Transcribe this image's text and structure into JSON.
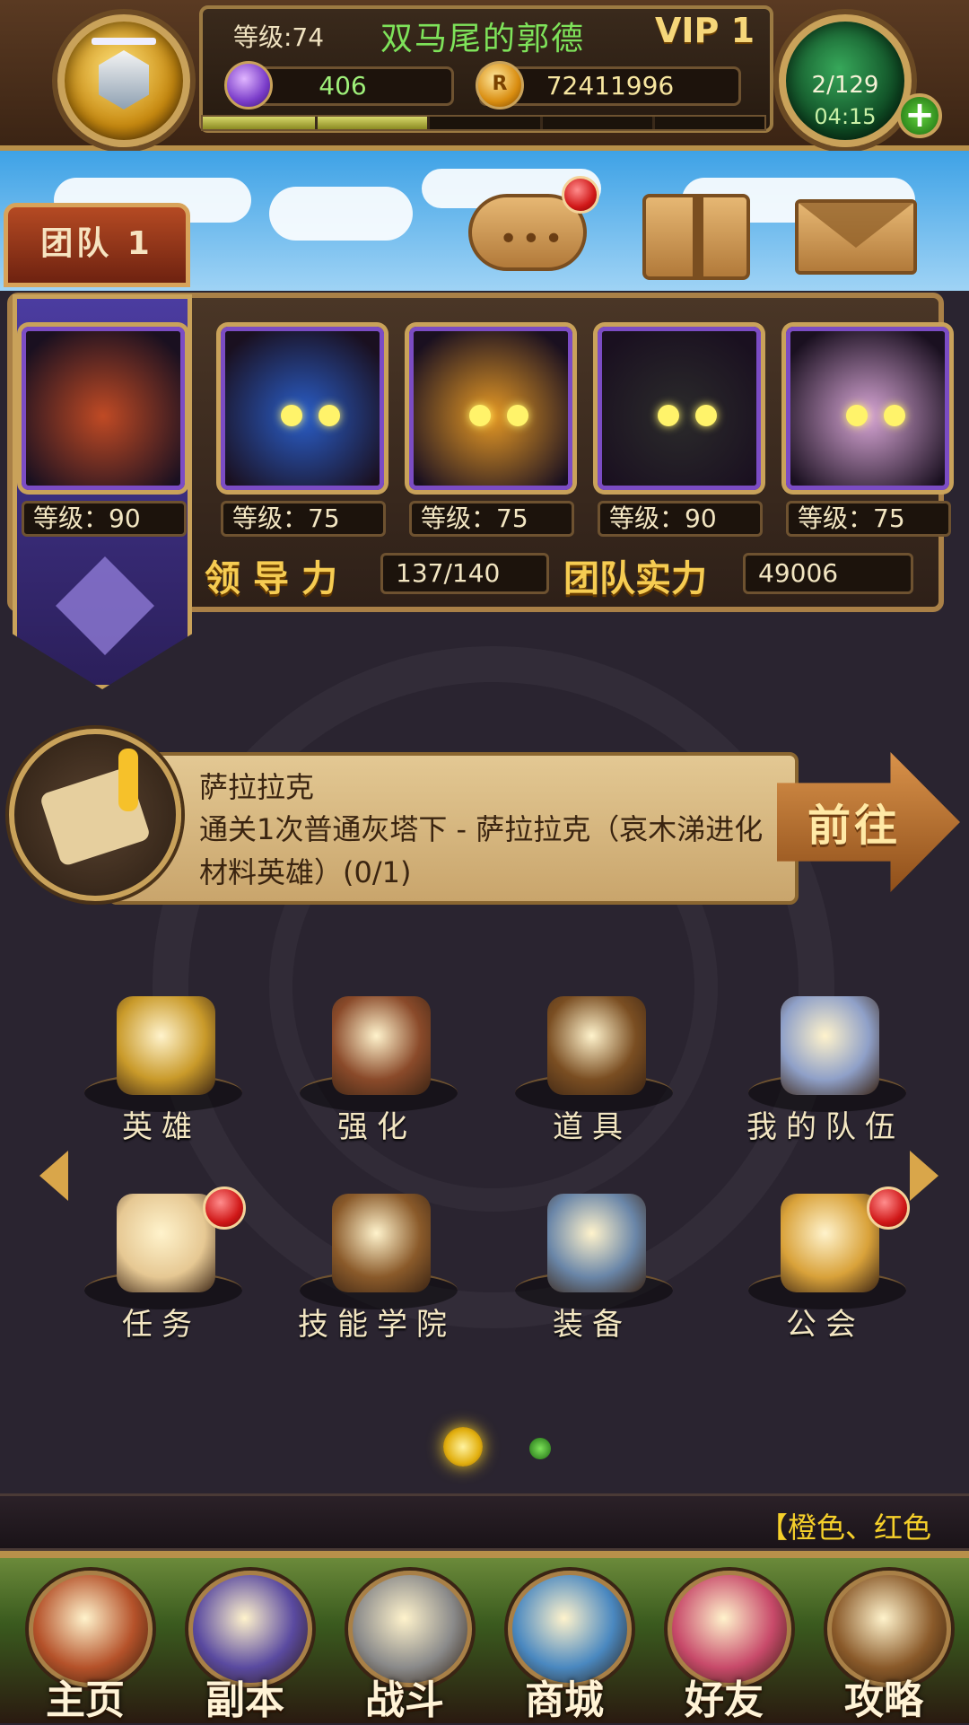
{
  "header": {
    "level": "等级:74",
    "player_name": "双马尾的郭德",
    "vip": "VIP 1",
    "gems": "406",
    "gold": "72411996",
    "gold_icon_glyph": "R",
    "stamina": "2/129",
    "stamina_timer": "04:15",
    "plus": "+",
    "exp_progress": 0.4
  },
  "team_tab": {
    "label": "团队 1"
  },
  "sky_buttons": {
    "chat_dots": "•••"
  },
  "team": {
    "heroes": [
      {
        "level_label": "等级：",
        "level": "90",
        "color": "#c04a24"
      },
      {
        "level_label": "等级：",
        "level": "75",
        "color": "#2a5ec9"
      },
      {
        "level_label": "等级：",
        "level": "75",
        "color": "#e79a25"
      },
      {
        "level_label": "等级：",
        "level": "90",
        "color": "#2b2b2b"
      },
      {
        "level_label": "等级：",
        "level": "75",
        "color": "#d8a6d6"
      }
    ],
    "leadership_label": "领导力",
    "leadership_value": "137/140",
    "power_label": "团队实力",
    "power_value": "49006"
  },
  "quest": {
    "title": "萨拉拉克",
    "description": "通关1次普通灰塔下 - 萨拉拉克（哀木涕进化材料英雄）(0/1)",
    "go_label": "前往"
  },
  "menu": {
    "row1": [
      {
        "label": "英雄",
        "icon": "hero-card-icon",
        "color": "#c99a2a",
        "badge": false
      },
      {
        "label": "强化",
        "icon": "forge-icon",
        "color": "#8a4a2a",
        "badge": false
      },
      {
        "label": "道具",
        "icon": "backpack-icon",
        "color": "#7a4e22",
        "badge": false
      },
      {
        "label": "我的队伍",
        "icon": "crossed-swords-icon",
        "color": "#8fa0c8",
        "badge": false
      }
    ],
    "row2": [
      {
        "label": "任务",
        "icon": "scroll-quest-icon",
        "color": "#e6c893",
        "badge": true
      },
      {
        "label": "技能学院",
        "icon": "spellbook-icon",
        "color": "#8a5a2a",
        "badge": false
      },
      {
        "label": "装备",
        "icon": "anvil-icon",
        "color": "#6a86a8",
        "badge": false
      },
      {
        "label": "公会",
        "icon": "guild-shield-icon",
        "color": "#d9a23a",
        "badge": true
      }
    ]
  },
  "ticker": {
    "text": "【橙色、红色"
  },
  "bottom_nav": [
    {
      "label": "主页",
      "icon": "house-icon",
      "color": "#b5522a"
    },
    {
      "label": "副本",
      "icon": "skull-icon",
      "color": "#5a4aa0"
    },
    {
      "label": "战斗",
      "icon": "sword-axe-icon",
      "color": "#8a8a8a"
    },
    {
      "label": "商城",
      "icon": "shop-creature-icon",
      "color": "#4a88c0"
    },
    {
      "label": "好友",
      "icon": "friends-icon",
      "color": "#c84a6a"
    },
    {
      "label": "攻略",
      "icon": "guide-book-icon",
      "color": "#8a5a2a"
    }
  ]
}
